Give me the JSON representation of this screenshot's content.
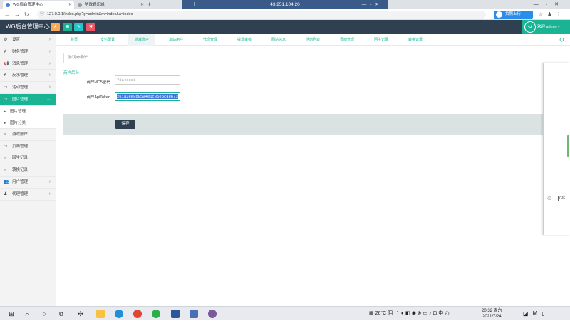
{
  "browser": {
    "tabs": [
      {
        "title": "WG后台管理中心"
      },
      {
        "title": "华歌娱乐城"
      }
    ],
    "remote_title": "43.251.104.20",
    "url": "127.0.0.1/index.php?g=admin&m=index&a=index",
    "upload_label": "拍照上传"
  },
  "app": {
    "brand": "WG后台管理中心",
    "header_buttons": [
      "★",
      "▦",
      "✎",
      "✖"
    ],
    "user_label": "欢迎 admin ▾"
  },
  "sidebar": {
    "items": [
      {
        "label": "设置",
        "icon": "⚙"
      },
      {
        "label": "财务管理",
        "icon": "¥"
      },
      {
        "label": "消息管理",
        "icon": "📢"
      },
      {
        "label": "反水管理",
        "icon": "¥"
      },
      {
        "label": "活动管理",
        "icon": "▭"
      },
      {
        "label": "图片管理",
        "icon": "▭"
      },
      {
        "label": "游戏账户",
        "icon": "∞"
      },
      {
        "label": "页面管理",
        "icon": "▭"
      },
      {
        "label": "回生记录",
        "icon": "∞"
      },
      {
        "label": "转换记录",
        "icon": "∞"
      },
      {
        "label": "用户管理",
        "icon": "👥"
      },
      {
        "label": "代理管理",
        "icon": "♟"
      }
    ],
    "subitems": [
      "图片管理",
      "图片分类"
    ]
  },
  "page_tabs": [
    "首页",
    "支付配置",
    "游戏账户",
    "本站用户",
    "代理管理",
    "提现审核",
    "网站信息",
    "活动列表",
    "页面管理",
    "回生记录",
    "转换记录"
  ],
  "form": {
    "card_tab": "游戏api账户",
    "section_title": "商户后台",
    "md5_label": "商户MD5密码",
    "md5_value": "73a4eea1",
    "token_label": "商户ApiToken",
    "token_value": "261a2ee8b8504e1c85e5cae673",
    "save_label": "保存"
  },
  "taskbar": {
    "weather": "26°C 阴",
    "time": "20:32 周六",
    "date": "2021/7/24"
  },
  "colors": {
    "header": "#2f4050",
    "accent": "#1ab394"
  }
}
